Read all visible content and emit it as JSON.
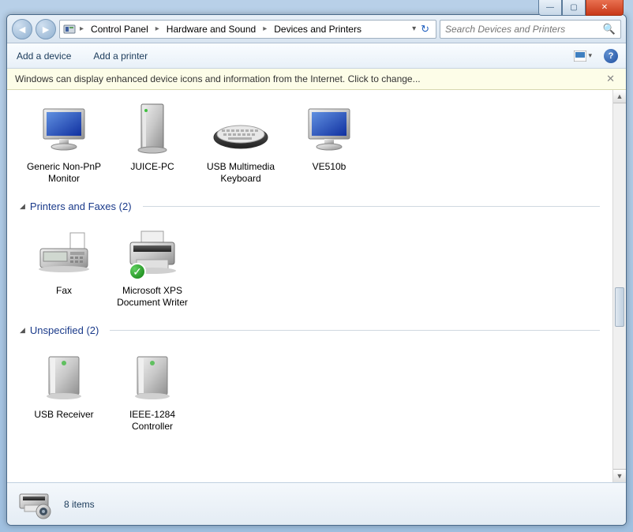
{
  "window_controls": {
    "min": "—",
    "max": "▢",
    "close": "✕"
  },
  "breadcrumb": {
    "items": [
      "Control Panel",
      "Hardware and Sound",
      "Devices and Printers"
    ]
  },
  "search": {
    "placeholder": "Search Devices and Printers"
  },
  "toolbar": {
    "add_device": "Add a device",
    "add_printer": "Add a printer"
  },
  "info_bar": {
    "text": "Windows can display enhanced device icons and information from the Internet. Click to change..."
  },
  "groups": {
    "devices": {
      "header_partial": "",
      "items": [
        {
          "label": "Generic Non-PnP Monitor",
          "icon": "monitor"
        },
        {
          "label": "JUICE-PC",
          "icon": "pc-tower"
        },
        {
          "label": "USB Multimedia Keyboard",
          "icon": "keyboard"
        },
        {
          "label": "VE510b",
          "icon": "monitor"
        }
      ]
    },
    "printers": {
      "header": "Printers and Faxes (2)",
      "items": [
        {
          "label": "Fax",
          "icon": "fax"
        },
        {
          "label": "Microsoft XPS Document Writer",
          "icon": "printer",
          "default": true
        }
      ]
    },
    "unspecified": {
      "header": "Unspecified (2)",
      "items": [
        {
          "label": "USB Receiver",
          "icon": "device-box"
        },
        {
          "label": "IEEE-1284 Controller",
          "icon": "device-box"
        }
      ]
    }
  },
  "status": {
    "count_text": "8 items"
  }
}
